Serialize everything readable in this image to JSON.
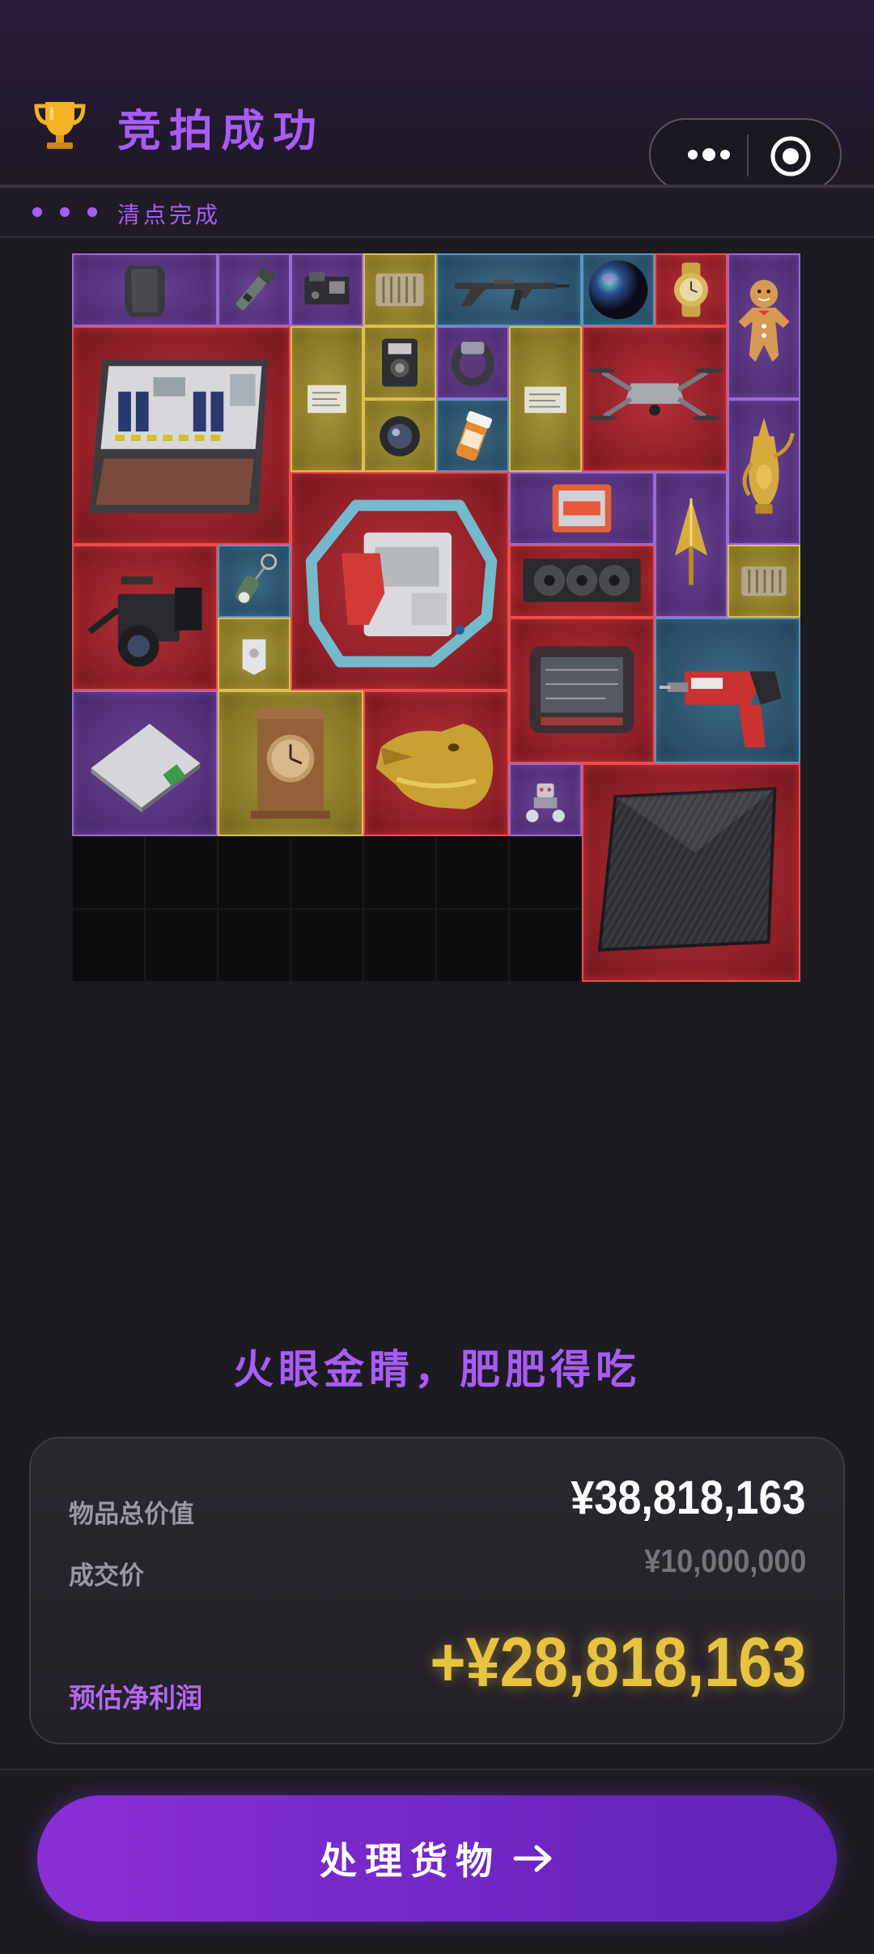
{
  "header": {
    "title": "竞拍成功",
    "status": "清点完成",
    "icons": {
      "trophy": "trophy-icon",
      "more": "more-dots-icon",
      "close": "target-circle-icon"
    }
  },
  "colors": {
    "accent": "#a85cf5",
    "gold": "#e8c241",
    "rarity_red": "#ef4b4e",
    "rarity_gold": "#d9c04f",
    "rarity_purple": "#9a6ad6",
    "rarity_blue": "#5a96c0"
  },
  "items": [
    {
      "name": "armor-plate",
      "rarity": "purple"
    },
    {
      "name": "flashlight",
      "rarity": "purple"
    },
    {
      "name": "circuit-module",
      "rarity": "purple"
    },
    {
      "name": "heatsink",
      "rarity": "gold"
    },
    {
      "name": "assault-rifle",
      "rarity": "blue"
    },
    {
      "name": "iridescent-sphere",
      "rarity": "blue"
    },
    {
      "name": "gold-watch",
      "rarity": "red"
    },
    {
      "name": "gingerbread-man",
      "rarity": "purple"
    },
    {
      "name": "server-rack",
      "rarity": "red"
    },
    {
      "name": "documents",
      "rarity": "gold"
    },
    {
      "name": "electronic-meter",
      "rarity": "gold"
    },
    {
      "name": "ring",
      "rarity": "purple"
    },
    {
      "name": "folder",
      "rarity": "gold"
    },
    {
      "name": "drone",
      "rarity": "red"
    },
    {
      "name": "camera-lens",
      "rarity": "gold"
    },
    {
      "name": "pill-bottle",
      "rarity": "blue"
    },
    {
      "name": "golden-ewer",
      "rarity": "purple"
    },
    {
      "name": "medical-machine",
      "rarity": "red"
    },
    {
      "name": "ssd",
      "rarity": "purple"
    },
    {
      "name": "golden-arrowhead",
      "rarity": "purple"
    },
    {
      "name": "graphics-card",
      "rarity": "red"
    },
    {
      "name": "video-camera",
      "rarity": "red"
    },
    {
      "name": "green-keychain",
      "rarity": "blue"
    },
    {
      "name": "white-key",
      "rarity": "gold"
    },
    {
      "name": "small-heatsink",
      "rarity": "gold"
    },
    {
      "name": "monitor-device",
      "rarity": "red"
    },
    {
      "name": "hammer-drill",
      "rarity": "blue"
    },
    {
      "name": "ssd-drive",
      "rarity": "purple"
    },
    {
      "name": "antique-clock",
      "rarity": "gold"
    },
    {
      "name": "golden-crocodile-head",
      "rarity": "red"
    },
    {
      "name": "robot-toy",
      "rarity": "purple"
    },
    {
      "name": "carbon-panel",
      "rarity": "red"
    }
  ],
  "slogan": "火眼金睛，肥肥得吃",
  "summary": {
    "total_label": "物品总价值",
    "total_value": "¥38,818,163",
    "deal_label": "成交价",
    "deal_value": "¥10,000,000",
    "profit_label": "预估净利润",
    "profit_value": "+¥28,818,163"
  },
  "action": {
    "label": "处理货物",
    "arrow_icon": "arrow-right-icon"
  }
}
